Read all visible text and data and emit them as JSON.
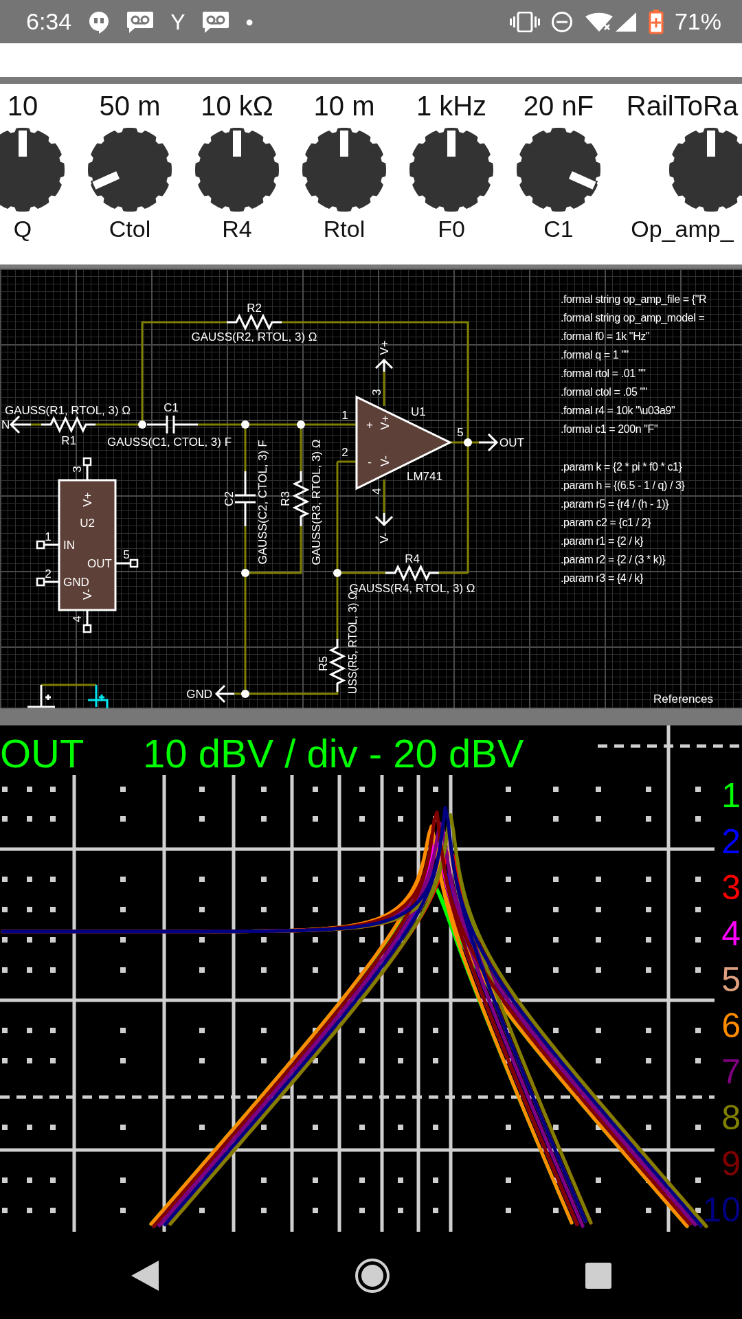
{
  "status_bar": {
    "time": "6:34",
    "notification_glyphs": [
      "Y",
      "•"
    ],
    "battery": "71%"
  },
  "knobs": [
    {
      "value": "10",
      "label": "Q",
      "level": 0.5
    },
    {
      "value": "50 m",
      "label": "Ctol",
      "level": 0.12
    },
    {
      "value": "10 kΩ",
      "label": "R4",
      "level": 0.5
    },
    {
      "value": "10 m",
      "label": "Rtol",
      "level": 0.5
    },
    {
      "value": "1 kHz",
      "label": "F0",
      "level": 0.5
    },
    {
      "value": "20 nF",
      "label": "C1",
      "level": 0.88
    },
    {
      "value": "RailToRa",
      "label": "Op_amp_",
      "level": 0.5
    }
  ],
  "schematic": {
    "input_net": "N",
    "output_net": "OUT",
    "ground_net": "GND",
    "components": {
      "r1": {
        "ref": "R1",
        "value": "GAUSS(R1, RTOL, 3) Ω"
      },
      "c1": {
        "ref": "C1",
        "value": "GAUSS(C1, CTOL, 3) F"
      },
      "r2": {
        "ref": "R2",
        "value": "GAUSS(R2, RTOL, 3) Ω"
      },
      "c2": {
        "ref": "C2",
        "value": "GAUSS(C2, CTOL, 3) F"
      },
      "r3": {
        "ref": "R3",
        "value": "GAUSS(R3, RTOL, 3) Ω"
      },
      "r4": {
        "ref": "R4",
        "value": "GAUSS(R4, RTOL, 3) Ω"
      },
      "r5": {
        "ref": "R5",
        "value": "USS(R5, RTOL, 3) Ω"
      }
    },
    "op_amp": {
      "ref": "U1",
      "model": "LM741",
      "pin_numbers": [
        "1",
        "2",
        "3",
        "4",
        "5"
      ],
      "inner_labels": [
        "+",
        "V+",
        "-",
        "V-"
      ],
      "supply_labels": [
        "V+",
        "V-"
      ]
    },
    "block": {
      "ref": "U2",
      "pin_numbers": [
        "3",
        "1",
        "2",
        "5",
        "4"
      ],
      "pin_names": [
        "V+",
        "IN",
        "GND",
        "OUT",
        "V-"
      ]
    },
    "netlist": [
      ".formal string op_amp_file = {\"R",
      ".formal string op_amp_model =",
      ".formal f0 = 1k \"Hz\"",
      ".formal q = 1 \"\"",
      ".formal rtol = .01 \"\"",
      ".formal ctol = .05 \"\"",
      ".formal r4 = 10k \"\\u03a9\"",
      ".formal c1 = 200n \"F\"",
      ".param k = {2 * pi * f0 * c1}",
      ".param h = {(6.5 - 1 / q) / 3}",
      ".param r5 = {r4 / (h - 1)}",
      ".param c2 = {c1 / 2}",
      ".param r1 = {2 / k}",
      ".param r2 = {2 / (3 * k)}",
      ".param r3 = {4 / k}"
    ],
    "references": "References"
  },
  "plot": {
    "title": "OUT",
    "scale": "10 dBV / div - 20 dBV",
    "traces": [
      {
        "label": "1",
        "color": "#00ff00"
      },
      {
        "label": "2",
        "color": "#0000ff"
      },
      {
        "label": "3",
        "color": "#ff0000"
      },
      {
        "label": "4",
        "color": "#ff00ff"
      },
      {
        "label": "5",
        "color": "#e0a080"
      },
      {
        "label": "6",
        "color": "#ff8c00"
      },
      {
        "label": "7",
        "color": "#800080"
      },
      {
        "label": "8",
        "color": "#808000"
      },
      {
        "label": "9",
        "color": "#800000"
      },
      {
        "label": "10",
        "color": "#000080"
      }
    ]
  }
}
